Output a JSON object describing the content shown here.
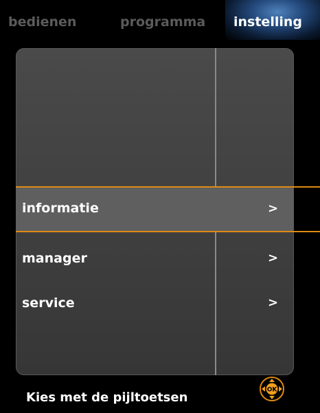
{
  "tabs": [
    {
      "label": "bedienen",
      "active": false
    },
    {
      "label": "programma",
      "active": false
    },
    {
      "label": "instelling",
      "active": true
    }
  ],
  "menu": {
    "items": [
      {
        "label": "informatie",
        "arrow": ">",
        "selected": true
      },
      {
        "label": "manager",
        "arrow": ">",
        "selected": false
      },
      {
        "label": "service",
        "arrow": ">",
        "selected": false
      }
    ]
  },
  "footer": {
    "hint": "Kies met de pijltoetsen",
    "ok_label": "OK"
  },
  "colors": {
    "accent": "#e08a12",
    "active_tab": "#2a5088",
    "background": "#000000"
  }
}
